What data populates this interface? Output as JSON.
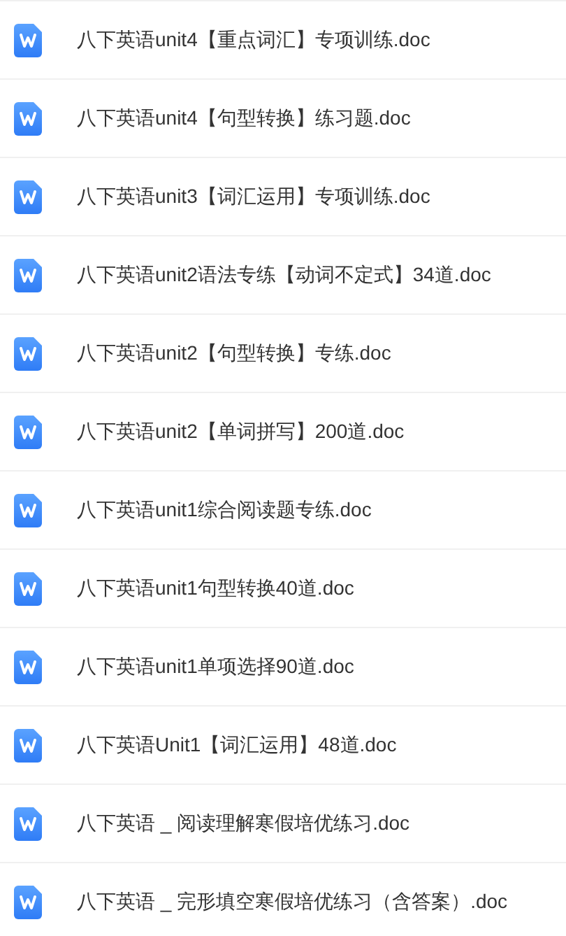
{
  "files": [
    {
      "name": "八下英语unit4【重点词汇】专项训练.doc"
    },
    {
      "name": "八下英语unit4【句型转换】练习题.doc"
    },
    {
      "name": "八下英语unit3【词汇运用】专项训练.doc"
    },
    {
      "name": "八下英语unit2语法专练【动词不定式】34道.doc"
    },
    {
      "name": "八下英语unit2【句型转换】专练.doc"
    },
    {
      "name": "八下英语unit2【单词拼写】200道.doc"
    },
    {
      "name": "八下英语unit1综合阅读题专练.doc"
    },
    {
      "name": "八下英语unit1句型转换40道.doc"
    },
    {
      "name": "八下英语unit1单项选择90道.doc"
    },
    {
      "name": "八下英语Unit1【词汇运用】48道.doc"
    },
    {
      "name": "八下英语 _ 阅读理解寒假培优练习.doc"
    },
    {
      "name": "八下英语 _ 完形填空寒假培优练习（含答案）.doc"
    }
  ]
}
